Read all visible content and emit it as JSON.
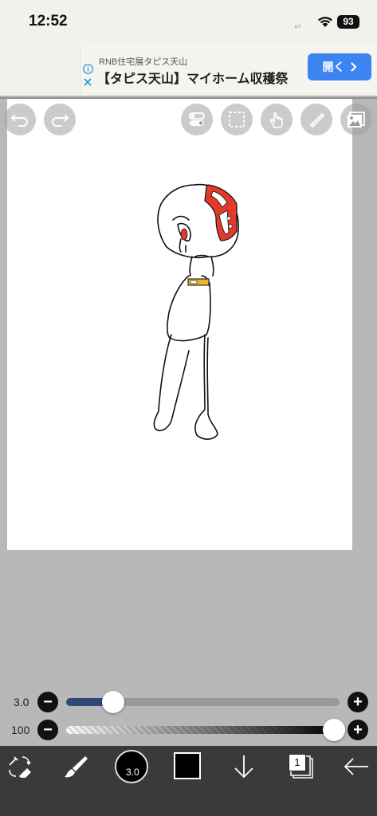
{
  "status_bar": {
    "time": "12:52",
    "battery": "93"
  },
  "ad": {
    "advertiser": "RNB住宅展タピス天山",
    "headline": "【タピス天山】マイホーム収穫祭",
    "cta_label": "開く",
    "cta_icon": "chevron-right-icon"
  },
  "top_toolbar": {
    "left_icons": [
      "undo-icon",
      "redo-icon"
    ],
    "right_icons": [
      "toggle-settings-icon",
      "selection-icon",
      "touch-icon",
      "pen-ruler-icon",
      "image-layer-icon"
    ]
  },
  "brush_size_slider": {
    "label": "3.0",
    "value": 3.0,
    "fill_fraction": 0.09,
    "minus": "−",
    "plus": "+"
  },
  "opacity_slider": {
    "label": "100",
    "value": 100,
    "fill_fraction": 1.0,
    "minus": "−",
    "plus": "+"
  },
  "bottom_toolbar": {
    "brush_size_text": "3.0",
    "current_color": "#000000",
    "layer_count": "1",
    "icons": [
      "transform-eraser-icon",
      "brush-icon",
      "brush-size-icon",
      "color-swatch-icon",
      "download-icon",
      "layers-icon",
      "back-arrow-icon"
    ]
  },
  "colors": {
    "accent_blue": "#3c85f0",
    "canvas_bg": "#ffffff",
    "app_bg": "#b8b8b8",
    "toolbar_bg": "#3a3a3a",
    "slider_fill": "#2f4a78"
  }
}
